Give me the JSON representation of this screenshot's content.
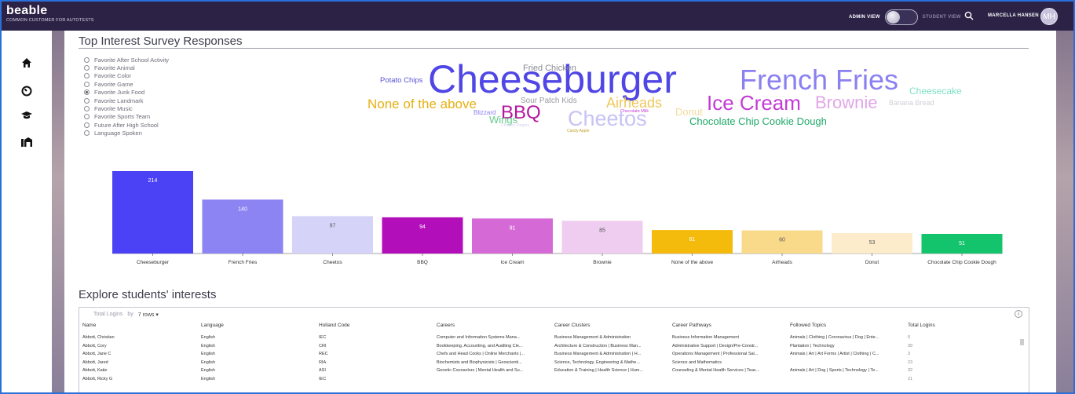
{
  "header": {
    "logo": "beable",
    "logo_sub": "COMMON CUSTOMER FOR AUTOTESTS",
    "admin_view": "ADMIN VIEW",
    "student_view": "STUDENT VIEW",
    "user_name": "MARCELLA HANSEN",
    "avatar_initials": "MH"
  },
  "sidebar": {
    "icons": [
      "home-icon",
      "dashboard-icon",
      "graduation-cap-icon",
      "library-icon"
    ]
  },
  "survey": {
    "title": "Top Interest Survey Responses",
    "options": [
      {
        "label": "Favorite After School Activity",
        "selected": false
      },
      {
        "label": "Favorite Animal",
        "selected": false
      },
      {
        "label": "Favorite Color",
        "selected": false
      },
      {
        "label": "Favorite Game",
        "selected": false
      },
      {
        "label": "Favorite Junk Food",
        "selected": true
      },
      {
        "label": "Favorite Landmark",
        "selected": false
      },
      {
        "label": "Favorite Music",
        "selected": false
      },
      {
        "label": "Favorite Sports Team",
        "selected": false
      },
      {
        "label": "Future After High School",
        "selected": false
      },
      {
        "label": "Language Spoken",
        "selected": false
      }
    ]
  },
  "word_cloud": [
    {
      "text": "Cheeseburger",
      "color": "#4f46e5"
    },
    {
      "text": "French Fries",
      "color": "#8b80f0"
    },
    {
      "text": "Cheesecake",
      "color": "#7ee0c4"
    },
    {
      "text": "Fried Chicken",
      "color": "#8a8a95"
    },
    {
      "text": "Potato Chips",
      "color": "#5856d6"
    },
    {
      "text": "None of the above",
      "color": "#e6b012"
    },
    {
      "text": "Sour Patch Kids",
      "color": "#9a9aa3"
    },
    {
      "text": "Airheads",
      "color": "#efc85b"
    },
    {
      "text": "Ice Cream",
      "color": "#c23bd4"
    },
    {
      "text": "Brownie",
      "color": "#e2a6e8"
    },
    {
      "text": "Banana Bread",
      "color": "#d0d0d6"
    },
    {
      "text": "BBQ",
      "color": "#b5179e"
    },
    {
      "text": "Cheetos",
      "color": "#c7c2f5"
    },
    {
      "text": "Blizzard",
      "color": "#8b80f0"
    },
    {
      "text": "Wings",
      "color": "#62cc8a"
    },
    {
      "text": "Donut",
      "color": "#f3dca0"
    },
    {
      "text": "Chocolate Chip Cookie Dough",
      "color": "#1ea968"
    },
    {
      "text": "Chocolate Milk",
      "color": "#c23bd4"
    },
    {
      "text": "Chicken Fingers",
      "color": "#d4d0f2"
    },
    {
      "text": "Candy Apple",
      "color": "#c1a32e"
    }
  ],
  "chart_data": {
    "type": "bar",
    "categories": [
      "Cheeseburger",
      "French Fries",
      "Cheetos",
      "BBQ",
      "Ice Cream",
      "Brownie",
      "None of the above",
      "Airheads",
      "Donut",
      "Chocolate Chip Cookie Dough"
    ],
    "values": [
      214,
      140,
      97,
      94,
      91,
      85,
      61,
      60,
      53,
      51
    ],
    "colors": [
      "#4b42f5",
      "#8c84f2",
      "#d5d3f7",
      "#b20eba",
      "#d56ad6",
      "#efcdf0",
      "#f5bb0c",
      "#f9d98a",
      "#fdeccc",
      "#14c46c"
    ],
    "label_colors": [
      "#ffffff",
      "#ffffff",
      "#555555",
      "#ffffff",
      "#ffffff",
      "#555555",
      "#ffffff",
      "#555555",
      "#555555",
      "#ffffff"
    ],
    "ylim": [
      0,
      214
    ]
  },
  "explore": {
    "title": "Explore students' interests",
    "toolbar_metric": "Total Logins",
    "toolbar_by": "by",
    "toolbar_rows": "7 rows",
    "info": "i",
    "columns": [
      "Name",
      "Language",
      "Holland Code",
      "Careers",
      "Career Clusters",
      "Career Pathways",
      "Followed Topics",
      "Total Logins"
    ],
    "rows": [
      [
        "Abbott, Christian",
        "English",
        "IEC",
        "Computer and Information Systems Mana...",
        "Business Management & Administration",
        "Business Information Management",
        "Animals | Clothing | Coronavirus | Dog | Ente...",
        "0"
      ],
      [
        "Abbott, Cory",
        "English",
        "CRI",
        "Bookkeeping, Accounting, and Auditing Cle...",
        "Architecture & Construction | Business Man...",
        "Administrative Support | Design/Pre-Constr...",
        "Plantation | Technology",
        "39"
      ],
      [
        "Abbott, Jane C",
        "English",
        "REC",
        "Chefs and Head Cooks | Online Merchants |...",
        "Business Management & Administration | H...",
        "Operations Management | Professional Sal...",
        "Animals | Art | Art Forms | Artist | Clothing | C...",
        "3"
      ],
      [
        "Abbott, Jared",
        "English",
        "RIA",
        "Biochemists and Biophysicists | Geoscienti...",
        "Science, Technology, Engineering & Mathe...",
        "Science and Mathematics",
        "",
        "23"
      ],
      [
        "Abbott, Katie",
        "English",
        "ASI",
        "Genetic Counselors | Mental Health and Su...",
        "Education & Training | Health Science | Hum...",
        "Counseling & Mental Health Services | Teac...",
        "Animals | Art | Dog | Sports | Technology | Te...",
        "32"
      ],
      [
        "Abbott, Ricky G",
        "English",
        "IEC",
        "",
        "",
        "",
        "",
        "21"
      ]
    ]
  }
}
